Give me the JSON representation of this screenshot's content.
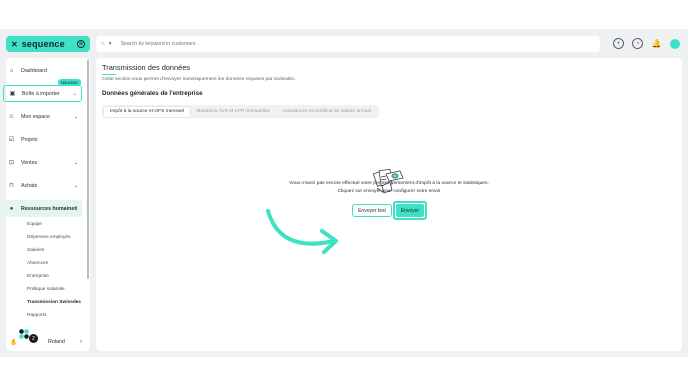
{
  "brand": {
    "name": "sequence",
    "mark": "✕",
    "accent": "#3fe0c5"
  },
  "search": {
    "placeholder": "Search by keyword in customers"
  },
  "sidebar": {
    "items": [
      {
        "label": "Dashboard",
        "icon": "home-icon"
      },
      {
        "label": "Boîte à importer",
        "icon": "inbox-icon",
        "badge": "Nouveau"
      },
      {
        "label": "Mon espace",
        "icon": "user-icon"
      },
      {
        "label": "Projets",
        "icon": "checkbox-icon"
      },
      {
        "label": "Ventes",
        "icon": "lock-icon"
      },
      {
        "label": "Achats",
        "icon": "bag-icon"
      },
      {
        "label": "Ressources humaines",
        "icon": "people-icon"
      }
    ],
    "subitems": [
      "Equipe",
      "Dépenses employés",
      "Salaires",
      "Absences",
      "Entreprise",
      "Politique salariale",
      "Transmission Swissdec",
      "Rapports"
    ],
    "footer": {
      "name": "Roland",
      "help_badge": "2"
    }
  },
  "main": {
    "title": "Transmission des données",
    "description": "Cette section vous permet d'envoyer numériquement les données requises par Swissdec.",
    "section_title": "Données générales de l'entreprise",
    "tabs": [
      "Impôt à la source et OFS mensuel",
      "Mutations AVS et LPP mensuelles",
      "Assurances et certificat de salaire annuel"
    ],
    "empty_line1": "Vous n'avez pas encore effectué votre premier versement d'impôt à la source et statistiques.",
    "empty_line2": "Cliquez sur envoyer pour configurer votre envoi",
    "btn_test": "Envoyer test",
    "btn_send": "Envoyer"
  }
}
